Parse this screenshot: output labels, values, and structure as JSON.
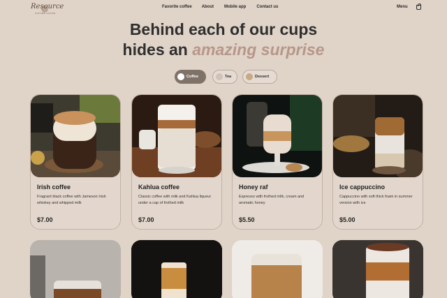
{
  "header": {
    "logo_text": "Resource",
    "logo_sub": "COFFEE HOUSE",
    "nav": [
      "Favorite coffee",
      "About",
      "Mobile app",
      "Contact us"
    ],
    "menu_label": "Menu",
    "cart_icon": "shopping-bag-icon"
  },
  "hero": {
    "line1": "Behind each of our cups",
    "line2_plain": "hides an ",
    "line2_accent": "amazing surprise"
  },
  "tabs": [
    {
      "label": "Coffee",
      "icon": "coffee-icon",
      "active": true
    },
    {
      "label": "Tea",
      "icon": "tea-icon",
      "active": false
    },
    {
      "label": "Dessert",
      "icon": "dessert-icon",
      "active": false
    }
  ],
  "products": [
    {
      "name": "Irish coffee",
      "description": "Fragrant black coffee with Jameson Irish whiskey and whipped milk",
      "price": "$7.00"
    },
    {
      "name": "Kahlua coffee",
      "description": "Classic coffee with milk and Kahlua liqueur under a cap of frothed milk",
      "price": "$7.00"
    },
    {
      "name": "Honey raf",
      "description": "Espresso with frothed milk, cream and aromatic honey",
      "price": "$5.50"
    },
    {
      "name": "Ice cappuccino",
      "description": "Cappuccino with soft thick foam in summer version with ice",
      "price": "$5.00"
    }
  ],
  "colors": {
    "background": "#e0d3c8",
    "accent": "#b7978a",
    "active_tab": "#7f7267"
  }
}
